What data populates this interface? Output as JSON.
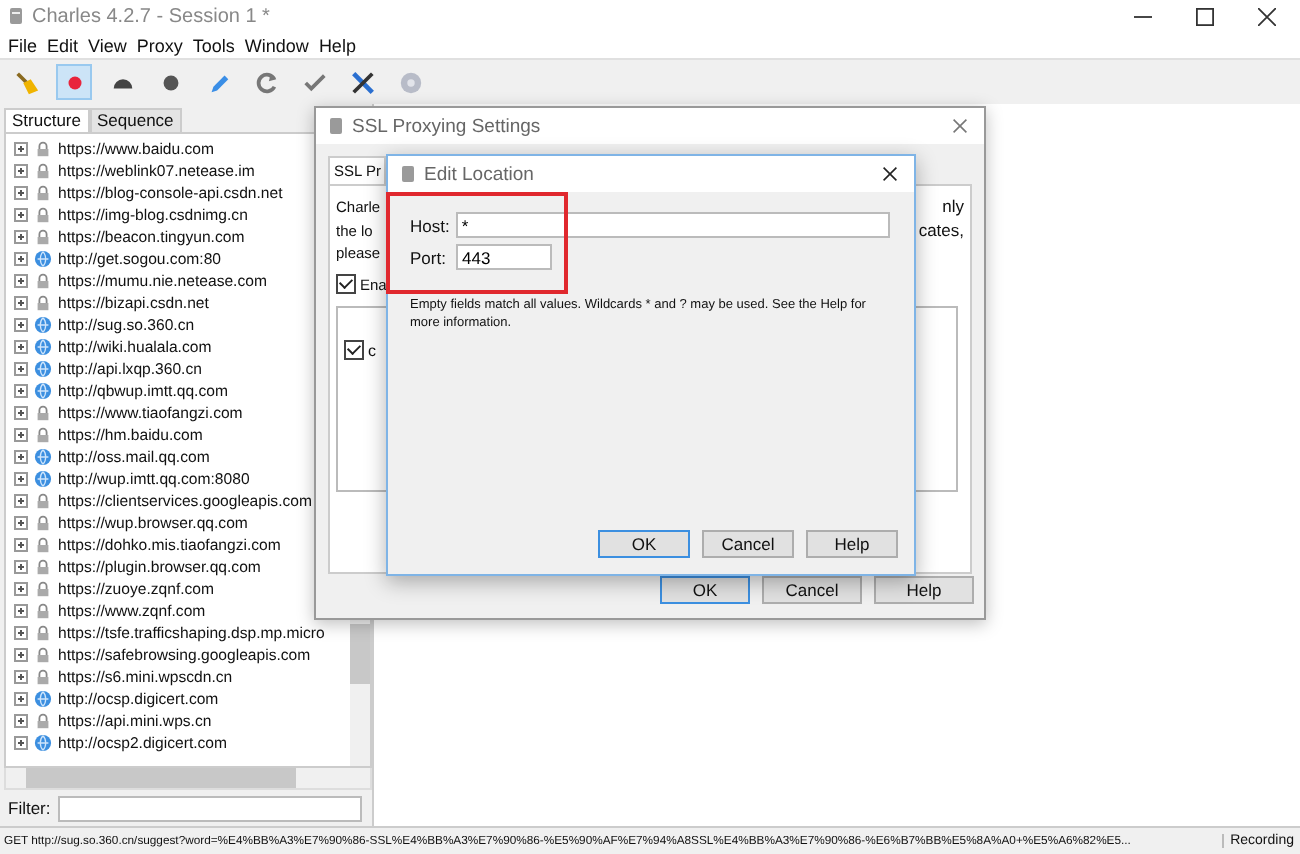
{
  "window": {
    "title": "Charles 4.2.7 - Session 1 *"
  },
  "menu": [
    "File",
    "Edit",
    "View",
    "Proxy",
    "Tools",
    "Window",
    "Help"
  ],
  "toolbar": [
    {
      "kind": "broom",
      "selected": false
    },
    {
      "kind": "record",
      "selected": true
    },
    {
      "kind": "throttle",
      "selected": false
    },
    {
      "kind": "stop",
      "selected": false
    },
    {
      "kind": "pen",
      "selected": false
    },
    {
      "kind": "refresh",
      "selected": false
    },
    {
      "kind": "check",
      "selected": false
    },
    {
      "kind": "tools",
      "selected": false
    },
    {
      "kind": "settings",
      "selected": false
    }
  ],
  "view_tabs": [
    {
      "label": "Structure",
      "selected": true
    },
    {
      "label": "Sequence",
      "selected": false
    }
  ],
  "hosts": [
    {
      "kind": "https",
      "label": "https://www.baidu.com"
    },
    {
      "kind": "https",
      "label": "https://weblink07.netease.im"
    },
    {
      "kind": "https",
      "label": "https://blog-console-api.csdn.net"
    },
    {
      "kind": "https",
      "label": "https://img-blog.csdnimg.cn"
    },
    {
      "kind": "https",
      "label": "https://beacon.tingyun.com"
    },
    {
      "kind": "http",
      "label": "http://get.sogou.com:80"
    },
    {
      "kind": "https",
      "label": "https://mumu.nie.netease.com"
    },
    {
      "kind": "https",
      "label": "https://bizapi.csdn.net"
    },
    {
      "kind": "http",
      "label": "http://sug.so.360.cn"
    },
    {
      "kind": "http",
      "label": "http://wiki.hualala.com"
    },
    {
      "kind": "http",
      "label": "http://api.lxqp.360.cn"
    },
    {
      "kind": "http",
      "label": "http://qbwup.imtt.qq.com"
    },
    {
      "kind": "https",
      "label": "https://www.tiaofangzi.com"
    },
    {
      "kind": "https",
      "label": "https://hm.baidu.com"
    },
    {
      "kind": "http",
      "label": "http://oss.mail.qq.com"
    },
    {
      "kind": "http",
      "label": "http://wup.imtt.qq.com:8080"
    },
    {
      "kind": "https",
      "label": "https://clientservices.googleapis.com"
    },
    {
      "kind": "https",
      "label": "https://wup.browser.qq.com"
    },
    {
      "kind": "https",
      "label": "https://dohko.mis.tiaofangzi.com"
    },
    {
      "kind": "https",
      "label": "https://plugin.browser.qq.com"
    },
    {
      "kind": "https",
      "label": "https://zuoye.zqnf.com"
    },
    {
      "kind": "https",
      "label": "https://www.zqnf.com"
    },
    {
      "kind": "https",
      "label": "https://tsfe.trafficshaping.dsp.mp.micro"
    },
    {
      "kind": "https",
      "label": "https://safebrowsing.googleapis.com"
    },
    {
      "kind": "https",
      "label": "https://s6.mini.wpscdn.cn"
    },
    {
      "kind": "http",
      "label": "http://ocsp.digicert.com"
    },
    {
      "kind": "https",
      "label": "https://api.mini.wps.cn"
    },
    {
      "kind": "http",
      "label": "http://ocsp2.digicert.com"
    }
  ],
  "filter": {
    "label": "Filter:"
  },
  "status_bar": {
    "request": "GET http://sug.so.360.cn/suggest?word=%E4%BB%A3%E7%90%86-SSL%E4%BB%A3%E7%90%86-%E5%90%AF%E7%94%A8SSL%E4%BB%A3%E7%90%86-%E6%B7%BB%E5%8A%A0+%E5%A6%82%E5...",
    "state": "Recording"
  },
  "ssl_dialog": {
    "title": "SSL Proxying Settings",
    "tab": "SSL Pr",
    "left_lines": [
      "Charle",
      "the lo",
      "please"
    ],
    "right_lines": [
      "nly",
      "cates,"
    ],
    "enable": {
      "label": "Ena",
      "checked": true
    },
    "row_checked": true,
    "row_text": "c",
    "buttons": [
      "OK",
      "Cancel",
      "Help"
    ]
  },
  "edit_dialog": {
    "title": "Edit Location",
    "host": {
      "label": "Host:",
      "value": "*"
    },
    "port": {
      "label": "Port:",
      "value": "443"
    },
    "hint": "Empty fields match all values. Wildcards * and ? may be used. See the Help for more information.",
    "buttons": [
      "OK",
      "Cancel",
      "Help"
    ]
  }
}
